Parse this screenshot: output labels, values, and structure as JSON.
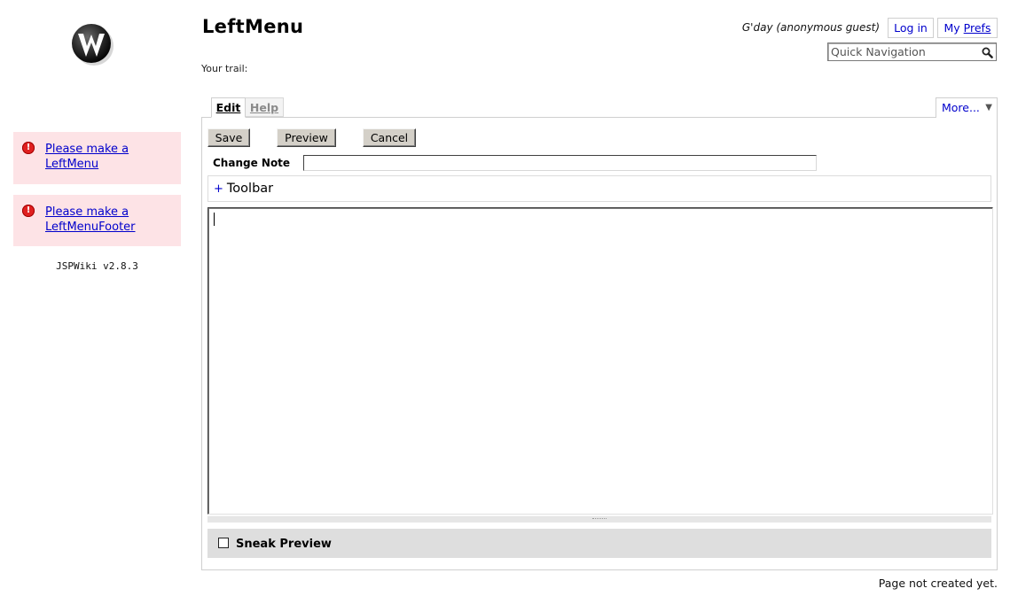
{
  "header": {
    "page_title": "LeftMenu",
    "trail_label": "Your trail:",
    "greeting": "G'day (anonymous guest)",
    "login_label": "Log in",
    "prefs_label_prefix": "My ",
    "prefs_label_underlined": "Prefs",
    "search_placeholder": "Quick Navigation"
  },
  "sidebar": {
    "warnings": [
      {
        "label": "Please make a LeftMenu"
      },
      {
        "label": "Please make a LeftMenuFooter"
      }
    ],
    "version": "JSPWiki v2.8.3"
  },
  "tabs": {
    "edit_label": "Edit",
    "help_label": "Help",
    "more_label": "More...",
    "more_caret": "▼"
  },
  "editor": {
    "save_label": "Save",
    "preview_label": "Preview",
    "cancel_label": "Cancel",
    "change_note_label": "Change Note",
    "change_note_value": "",
    "toolbar_label": "Toolbar",
    "toolbar_prefix": "+",
    "content": "",
    "sneak_preview_label": "Sneak Preview",
    "sneak_preview_checked": false
  },
  "footer": {
    "status": "Page not created yet."
  },
  "colors": {
    "link": "#0000cc",
    "warning_bg": "#fde3e6",
    "warning_icon": "#e02020",
    "button_face": "#d4d0c8",
    "sneak_bar_bg": "#dedede"
  },
  "icons": {
    "logo": "jspwiki-logo-icon",
    "warning": "exclamation-circle-icon",
    "search": "search-icon",
    "dropdown": "caret-down-icon"
  }
}
